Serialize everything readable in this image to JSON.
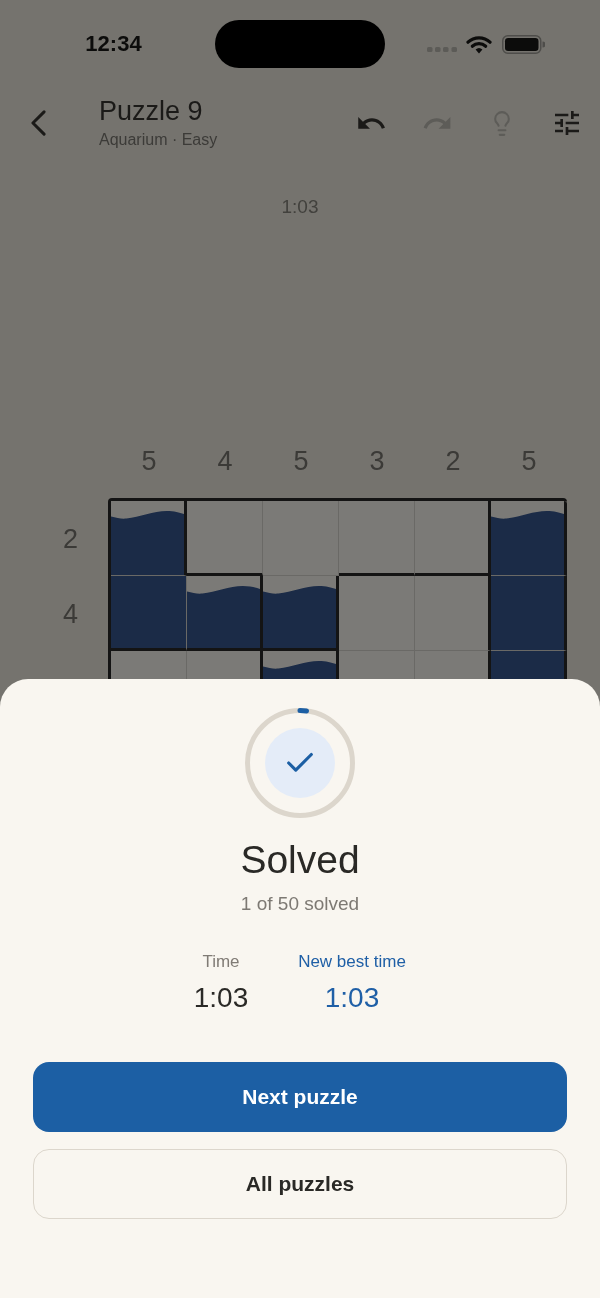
{
  "status_bar": {
    "time": "12:34"
  },
  "header": {
    "title": "Puzzle 9",
    "subtitle": "Aquarium · Easy",
    "tools": [
      {
        "kind": "undo",
        "disabled": false
      },
      {
        "kind": "redo",
        "disabled": true
      },
      {
        "kind": "hint",
        "disabled": true
      },
      {
        "kind": "settings",
        "disabled": false
      }
    ]
  },
  "timer": "1:03",
  "puzzle": {
    "column_clues": [
      "5",
      "4",
      "5",
      "3",
      "2",
      "5"
    ],
    "rows": [
      {
        "clue": "2",
        "cells": [
          {
            "kind": "surface",
            "wall_right": true,
            "wall_bottom": false
          },
          {
            "kind": "empty",
            "wall_right": false,
            "wall_bottom": true
          },
          {
            "kind": "empty",
            "wall_right": false,
            "wall_bottom": false
          },
          {
            "kind": "empty",
            "wall_right": false,
            "wall_bottom": true
          },
          {
            "kind": "empty",
            "wall_right": true,
            "wall_bottom": true
          },
          {
            "kind": "surface",
            "wall_bottom": false
          }
        ]
      },
      {
        "clue": "4",
        "cells": [
          {
            "kind": "water",
            "wall_right": false,
            "wall_bottom": true
          },
          {
            "kind": "surface",
            "wall_right": true,
            "wall_bottom": true
          },
          {
            "kind": "surface",
            "wall_right": true,
            "wall_bottom": true
          },
          {
            "kind": "empty",
            "wall_right": false,
            "wall_bottom": false
          },
          {
            "kind": "empty",
            "wall_right": true,
            "wall_bottom": false
          },
          {
            "kind": "water",
            "wall_bottom": false
          }
        ]
      },
      {
        "cells": [
          {
            "kind": "empty",
            "wall_right": false
          },
          {
            "kind": "empty",
            "wall_right": true
          },
          {
            "kind": "surface",
            "wall_right": true
          },
          {
            "kind": "empty",
            "wall_right": false
          },
          {
            "kind": "empty",
            "wall_right": true
          },
          {
            "kind": "water"
          }
        ]
      }
    ]
  },
  "result_sheet": {
    "title": "Solved",
    "progress_text": "1 of 50 solved",
    "stats": [
      {
        "label": "Time",
        "value": "1:03",
        "highlight": false
      },
      {
        "label": "New best time",
        "value": "1:03",
        "highlight": true
      }
    ],
    "buttons": [
      {
        "label": "Next puzzle",
        "kind": "primary"
      },
      {
        "label": "All puzzles",
        "kind": "secondary"
      }
    ]
  }
}
